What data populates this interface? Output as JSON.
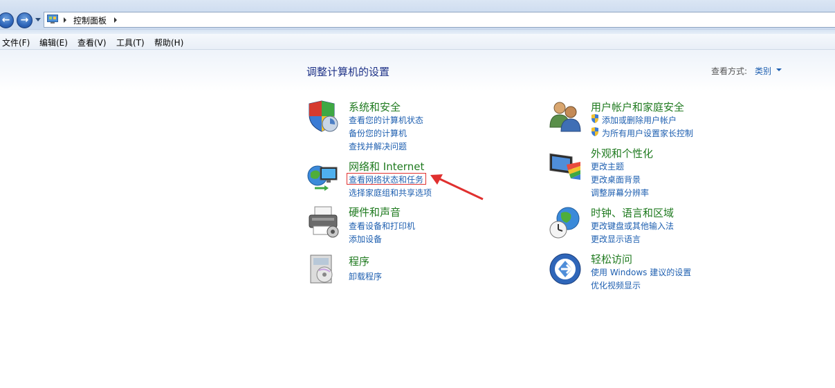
{
  "nav": {
    "back_icon": "back-arrow-icon",
    "forward_icon": "forward-arrow-icon",
    "breadcrumb_label": "控制面板"
  },
  "menu": [
    "文件(F)",
    "编辑(E)",
    "查看(V)",
    "工具(T)",
    "帮助(H)"
  ],
  "main": {
    "title": "调整计算机的设置",
    "view_label": "查看方式:",
    "view_value": "类别"
  },
  "categories": {
    "system": {
      "title": "系统和安全",
      "links": [
        "查看您的计算机状态",
        "备份您的计算机",
        "查找并解决问题"
      ]
    },
    "network": {
      "title": "网络和 Internet",
      "links": [
        "查看网络状态和任务",
        "选择家庭组和共享选项"
      ]
    },
    "hardware": {
      "title": "硬件和声音",
      "links": [
        "查看设备和打印机",
        "添加设备"
      ]
    },
    "programs": {
      "title": "程序",
      "links": [
        "卸载程序"
      ]
    },
    "users": {
      "title": "用户帐户和家庭安全",
      "links": [
        "添加或删除用户帐户",
        "为所有用户设置家长控制"
      ]
    },
    "appearance": {
      "title": "外观和个性化",
      "links": [
        "更改主题",
        "更改桌面背景",
        "调整屏幕分辨率"
      ]
    },
    "clock": {
      "title": "时钟、语言和区域",
      "links": [
        "更改键盘或其他输入法",
        "更改显示语言"
      ]
    },
    "ease": {
      "title": "轻松访问",
      "links": [
        "使用 Windows 建议的设置",
        "优化视频显示"
      ]
    }
  },
  "colors": {
    "category_title": "#1f7a1f",
    "link": "#1e5fb0",
    "annotation": "#e0302f"
  }
}
